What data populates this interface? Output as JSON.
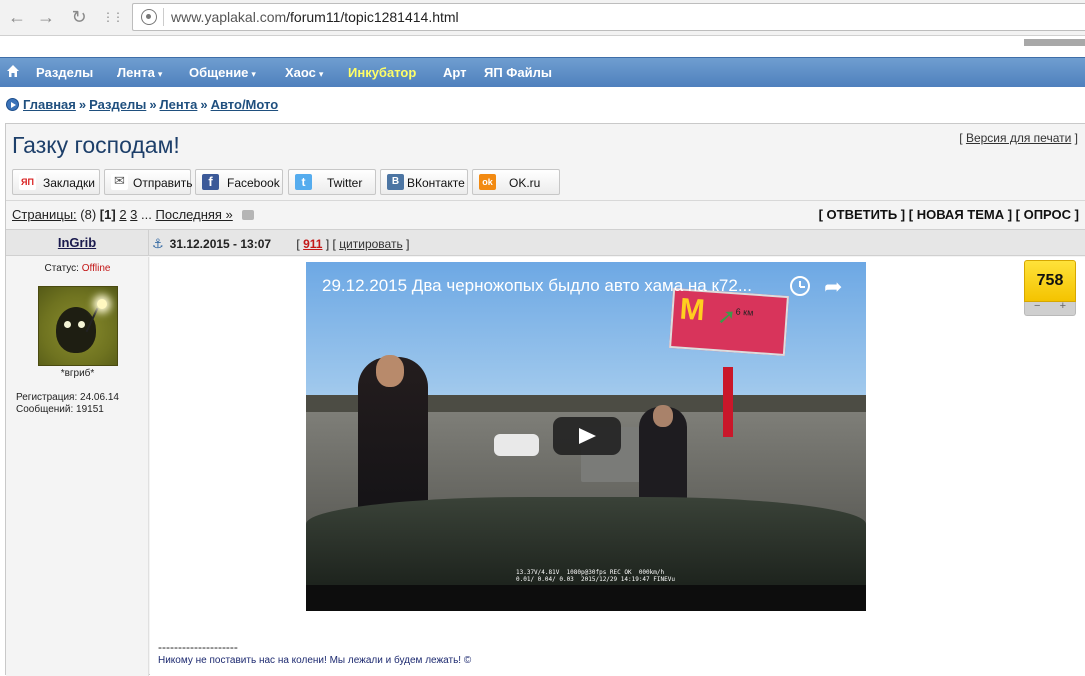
{
  "browser": {
    "url_host": "www.yaplakal.com",
    "url_path": "/forum11/topic1281414.html",
    "back_glyph": "←",
    "forward_glyph": "→",
    "reload_glyph": "↻",
    "apps_glyph": "⋮⋮"
  },
  "topnav": {
    "home_icon": "home-icon",
    "items": [
      {
        "label": "Разделы"
      },
      {
        "label": "Лента",
        "dropdown": "▾"
      },
      {
        "label": "Общение",
        "dropdown": "▾"
      },
      {
        "label": "Хаос",
        "dropdown": "▾"
      },
      {
        "label": "Инкубатор"
      },
      {
        "label": "Арт"
      },
      {
        "label": "ЯП Файлы"
      }
    ]
  },
  "breadcrumb": [
    {
      "label": "Главная"
    },
    {
      "label": "Раздел",
      "full": "Разделы"
    },
    {
      "label": "Лента"
    },
    {
      "label": "Авто/Мото"
    }
  ],
  "breadcrumb_sep": "»",
  "topic": {
    "title": "Газку господам!",
    "print_label": "Версия для печати",
    "print_open": "[",
    "print_close": "]"
  },
  "share": [
    {
      "label": "Закладки",
      "icon_text": "ЯП",
      "color": "#d92020"
    },
    {
      "label": "Отправить",
      "icon_text": "✉",
      "color": "#ffffff"
    },
    {
      "label": "Facebook",
      "icon_text": "f",
      "color": "#3b5998"
    },
    {
      "label": "Twitter",
      "icon_text": "t",
      "color": "#55acee"
    },
    {
      "label": "ВКонтакте",
      "icon_text": "В",
      "color": "#4c75a3"
    },
    {
      "label": "OK.ru",
      "icon_text": "ok",
      "color": "#f28a12"
    }
  ],
  "pager": {
    "label": "Страницы:",
    "count": "(8)",
    "current": "[1]",
    "pages": [
      "2",
      "3"
    ],
    "ellipsis": "...",
    "last": "Последняя »"
  },
  "actions": "[ ОТВЕТИТЬ ] [ НОВАЯ ТЕМА ] [ ОПРОС ]",
  "post": {
    "author": "InGrib",
    "anchor_icon": "⚓",
    "date": "31.12.2015 - 13:07",
    "num_open": "[",
    "num": "911",
    "num_close": "]",
    "quote_open": "[",
    "quote_label": "цитировать",
    "quote_close": "]",
    "status_label": "Статус:",
    "status_value": "Offline",
    "nickname": "*вгриб*",
    "reg_label": "Регистрация:",
    "reg_value": "24.06.14",
    "msgs_label": "Сообщений:",
    "msgs_value": "19151",
    "rating": "758",
    "rating_minus": "−",
    "rating_plus": "+",
    "signature_line": "--------------------",
    "signature": "Никому не поставить нас на колени! Мы лежали и будем лежать! ©"
  },
  "video": {
    "title": "29.12.2015 Два черножопых быдло авто хама на к72...",
    "share_glyph": "➦",
    "billboard_m": "M",
    "billboard_arrow": "➚",
    "billboard_km": "6 км",
    "osd": "13.37V/4.81V  1080p@30fps REC OK  000km/h\n0.01/ 0.04/ 0.03  2015/12/29 14:19:47 FINEVu"
  }
}
